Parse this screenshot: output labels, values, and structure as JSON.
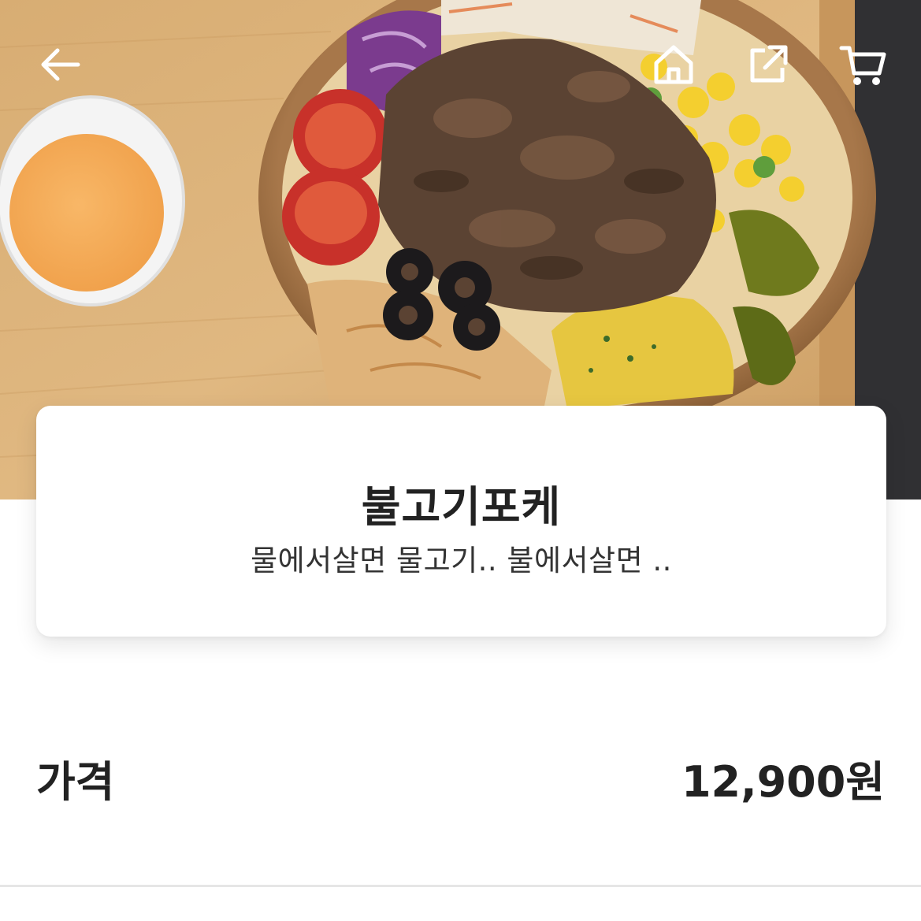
{
  "product": {
    "name": "불고기포케",
    "description": "물에서살면 물고기.. 불에서살면 .."
  },
  "price": {
    "label": "가격",
    "value": "12,900원"
  },
  "toolbar": {
    "back_icon": "arrow-left-icon",
    "home_icon": "home-icon",
    "share_icon": "share-icon",
    "cart_icon": "cart-icon"
  },
  "colors": {
    "text_primary": "#222222",
    "card_background": "#ffffff",
    "divider": "#e6e6e6"
  }
}
